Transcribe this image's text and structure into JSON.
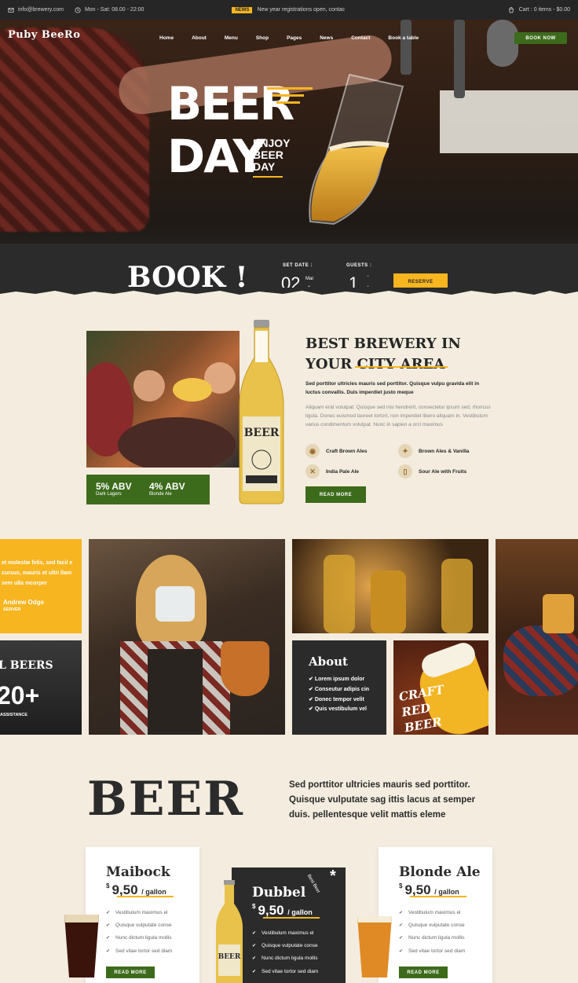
{
  "topbar": {
    "email": "info@brewery.com",
    "hours": "Mon - Sat: 08.00 - 22:00",
    "news_tag": "NEWS",
    "news_text": "New year registrations open, contac",
    "cart": "Cart : 0 items - $0.00"
  },
  "header": {
    "logo": "Puby BeeRo",
    "nav": [
      "Home",
      "About",
      "Menu",
      "Shop",
      "Pages",
      "News",
      "Contact",
      "Book a table"
    ],
    "book_now": "BOOK NOW"
  },
  "hero": {
    "line1": "BEER",
    "line2": "DAY",
    "sub1": "ENJOY",
    "sub2": "BEER",
    "sub3": "DAY"
  },
  "booking": {
    "title": "BOOK !",
    "date_label": "SET DATE :",
    "day": "02",
    "month": "Mar",
    "guests_label": "GUESTS :",
    "guests": "1",
    "reserve": "RESERVE"
  },
  "about": {
    "title_line1": "BEST BREWERY IN",
    "title_line2": "YOUR CITY AREA",
    "bold": "Sed porttitor ultricies mauris sed porttitor. Quisque vulpu gravida elit in luctus convallis. Duis imperdiet justo meque",
    "text": "Aliquam erat volutpat. Quisque sed nisi hendrerit, consectetur ipsum sed, rhoncus ligula. Donec euismod laoreet tortort, non imperdiet libero aliquam in. Vestibulum varius condimentum volutpat. Nunc in sapien a orci maximus",
    "features": [
      "Craft Brown Ales",
      "Brown Ales & Vanilla",
      "India Pale Ale",
      "Sour Ale with Fruits"
    ],
    "read_more": "READ MORE",
    "abv": [
      {
        "value": "5% ABV",
        "label": "Dark Lagers"
      },
      {
        "value": "4% ABV",
        "label": "Blonde Ale"
      }
    ],
    "bottle_label": "BEER"
  },
  "gallery": {
    "quote": "et molestie felis, sed facil e cursus, mauris et ultri llam sem ulla mcorper",
    "author": "Andrew Odge",
    "author_role": "SERVER",
    "beers_label": "L BEERS",
    "beers_count": "20+",
    "beers_sub": "ASSISTANCE",
    "about_title": "About",
    "about_items": [
      "Lorem ipsum dolor",
      "Conseutur adipis cin",
      "Donec tempor velit",
      "Quis vestibulum vel"
    ],
    "craft_text": "CRAFT RED BEER"
  },
  "menu": {
    "title": "BEER",
    "intro": "Sed porttitor ultricies mauris sed porttitor. Quisque vulputate sag ittis lacus at semper duis. pellentesque velit mattis eleme",
    "cards": [
      {
        "name": "Maibock",
        "currency": "$",
        "price": "9,50",
        "unit": "/ gallon",
        "items": [
          "Vestibulum maximus el",
          "Quisque vulputate conse",
          "Nunc dictum ligula mollis",
          "Sed vitae tortor sed diam"
        ],
        "button": "READ MORE"
      },
      {
        "name": "Dubbel",
        "currency": "$",
        "price": "9,50",
        "unit": "/ gallon",
        "items": [
          "Vestibulum maximus el",
          "Quisque vulputate conse",
          "Nunc dictum ligula mollis",
          "Sed vitae tortor sed diam"
        ],
        "badge": "Best Beer"
      },
      {
        "name": "Blonde Ale",
        "currency": "$",
        "price": "9,50",
        "unit": "/ gallon",
        "items": [
          "Vestibulum maximus el",
          "Quisque vulputate conse",
          "Nunc dictum ligula mollis",
          "Sed vitae tortor sed diam"
        ],
        "button": "READ MORE"
      }
    ]
  },
  "colors": {
    "accent": "#f7b520",
    "green": "#3d6b1c",
    "dark": "#2b2b2b",
    "cream": "#f3ecdf"
  }
}
